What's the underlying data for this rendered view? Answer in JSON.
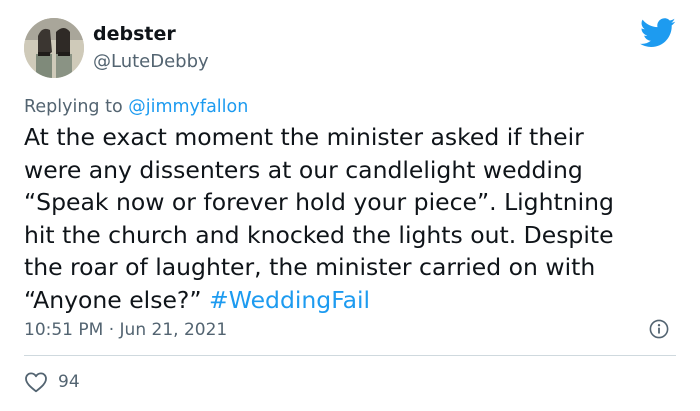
{
  "user": {
    "display_name": "debster",
    "handle": "@LuteDebby"
  },
  "reply": {
    "prefix": "Replying to ",
    "mention": "@jimmyfallon"
  },
  "tweet": {
    "text_lines": [
      "At the exact moment the minister asked if their",
      "were any dissenters at our candlelight wedding",
      "“Speak now or forever hold your piece”. Lightning",
      "hit the church and knocked the lights out. Despite",
      "the roar of laughter, the minister carried on with",
      "“Anyone else?” "
    ],
    "hashtag": "#WeddingFail"
  },
  "meta": {
    "time": "10:51 PM",
    "separator": " · ",
    "date": "Jun 21, 2021"
  },
  "engagement": {
    "likes": "94"
  },
  "icons": {
    "brand": "twitter-bird-icon",
    "info": "info-icon",
    "like": "heart-icon"
  },
  "colors": {
    "accent": "#1d9bf0",
    "secondary_text": "#536471",
    "primary_text": "#0f1419",
    "divider": "#cfd9de"
  }
}
